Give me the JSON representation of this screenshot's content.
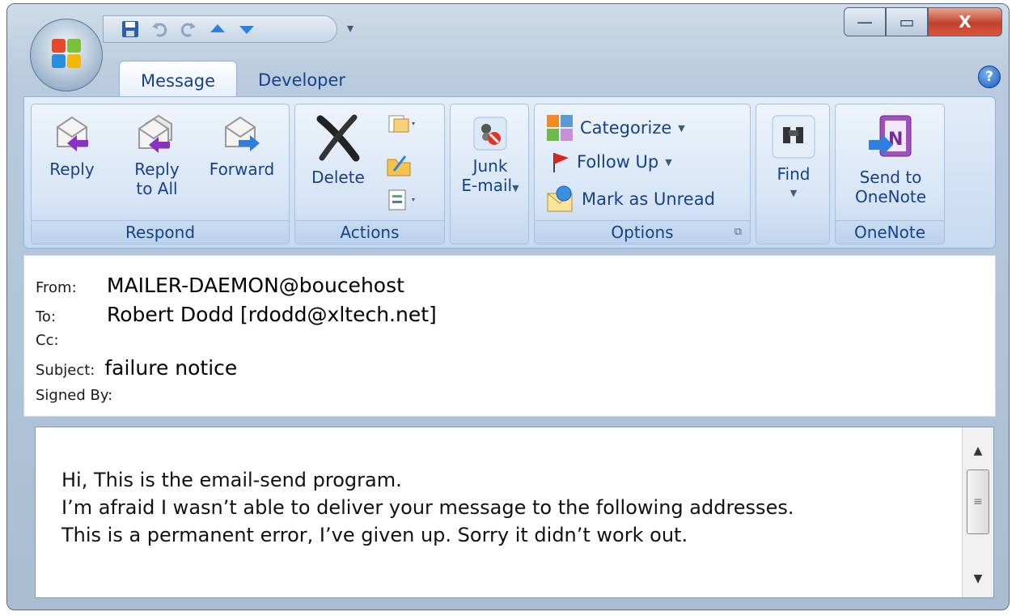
{
  "tabs": [
    {
      "label": "Message"
    },
    {
      "label": "Developer"
    }
  ],
  "window_controls": {
    "minimize": "—",
    "maximize": "▭",
    "close": "X"
  },
  "groups": {
    "respond": {
      "label": "Respond",
      "reply": "Reply",
      "reply_all_1": "Reply",
      "reply_all_2": "to All",
      "forward": "Forward"
    },
    "actions": {
      "label": "Actions",
      "delete": "Delete"
    },
    "junk": {
      "label_1": "Junk",
      "label_2": "E-mail"
    },
    "options": {
      "label": "Options",
      "categorize": "Categorize",
      "follow_up": "Follow Up",
      "mark_unread": "Mark as Unread"
    },
    "find": {
      "label": "Find"
    },
    "onenote": {
      "label": "OneNote",
      "send_1": "Send to",
      "send_2": "OneNote"
    }
  },
  "header": {
    "from_label": "From:",
    "from": "MAILER-DAEMON@boucehost",
    "to_label": "To:",
    "to": "Robert Dodd [rdodd@xltech.net]",
    "cc_label": "Cc:",
    "subject_label": "Subject:",
    "subject": "failure notice",
    "signed_label": "Signed By:"
  },
  "body": {
    "lines": [
      "Hi, This is the email-send program.",
      "I’m afraid I wasn’t able to deliver your message to the following addresses.",
      "This is a permanent error, I’ve given up. Sorry it didn’t work out."
    ]
  },
  "icons": {
    "office": "office-logo-icon",
    "save": "save-icon",
    "undo": "undo-icon",
    "redo": "redo-icon",
    "up": "previous-item-icon",
    "down": "next-item-icon",
    "help": "help-icon"
  },
  "help_label": "?"
}
